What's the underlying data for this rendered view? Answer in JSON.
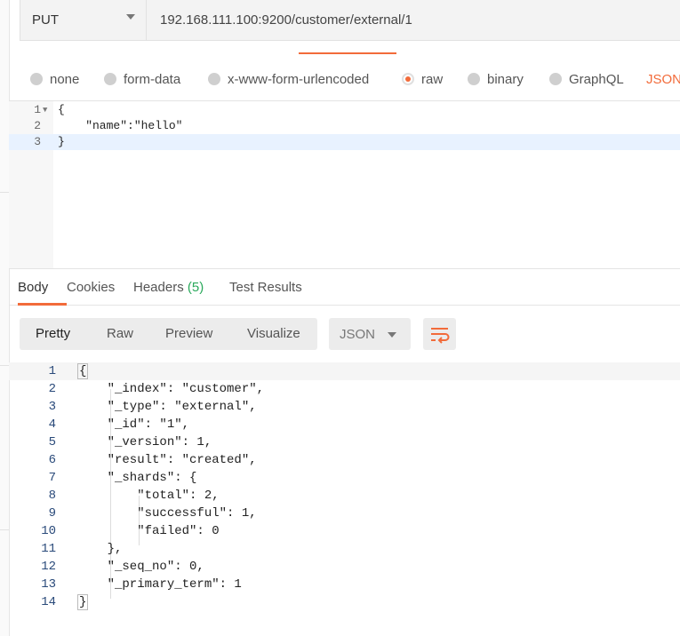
{
  "request": {
    "method": "PUT",
    "url": "192.168.111.100:9200/customer/external/1"
  },
  "body_options": [
    {
      "label": "none",
      "selected": false
    },
    {
      "label": "form-data",
      "selected": false
    },
    {
      "label": "x-www-form-urlencoded",
      "selected": false
    },
    {
      "label": "raw",
      "selected": true
    },
    {
      "label": "binary",
      "selected": false
    },
    {
      "label": "GraphQL",
      "selected": false
    }
  ],
  "body_format": "JSON",
  "editor_lines": [
    {
      "no": "1",
      "text": "{"
    },
    {
      "no": "2",
      "text": "    \"name\":\"hello\""
    },
    {
      "no": "3",
      "text": "}"
    }
  ],
  "response_tabs": {
    "body": "Body",
    "cookies": "Cookies",
    "headers": "Headers",
    "headers_count": "(5)",
    "test_results": "Test Results"
  },
  "view_modes": {
    "pretty": "Pretty",
    "raw": "Raw",
    "preview": "Preview",
    "visualize": "Visualize"
  },
  "response_format": "JSON",
  "wrap_icon": "wrap-lines-icon",
  "response_lines": [
    {
      "no": "1",
      "text": "{"
    },
    {
      "no": "2",
      "text": "    \"_index\": \"customer\","
    },
    {
      "no": "3",
      "text": "    \"_type\": \"external\","
    },
    {
      "no": "4",
      "text": "    \"_id\": \"1\","
    },
    {
      "no": "5",
      "text": "    \"_version\": 1,"
    },
    {
      "no": "6",
      "text": "    \"result\": \"created\","
    },
    {
      "no": "7",
      "text": "    \"_shards\": {"
    },
    {
      "no": "8",
      "text": "        \"total\": 2,"
    },
    {
      "no": "9",
      "text": "        \"successful\": 1,"
    },
    {
      "no": "10",
      "text": "        \"failed\": 0"
    },
    {
      "no": "11",
      "text": "    },"
    },
    {
      "no": "12",
      "text": "    \"_seq_no\": 0,"
    },
    {
      "no": "13",
      "text": "    \"_primary_term\": 1"
    },
    {
      "no": "14",
      "text": "}"
    }
  ],
  "colors": {
    "accent": "#f26b3a",
    "count_green": "#2aa95b"
  }
}
